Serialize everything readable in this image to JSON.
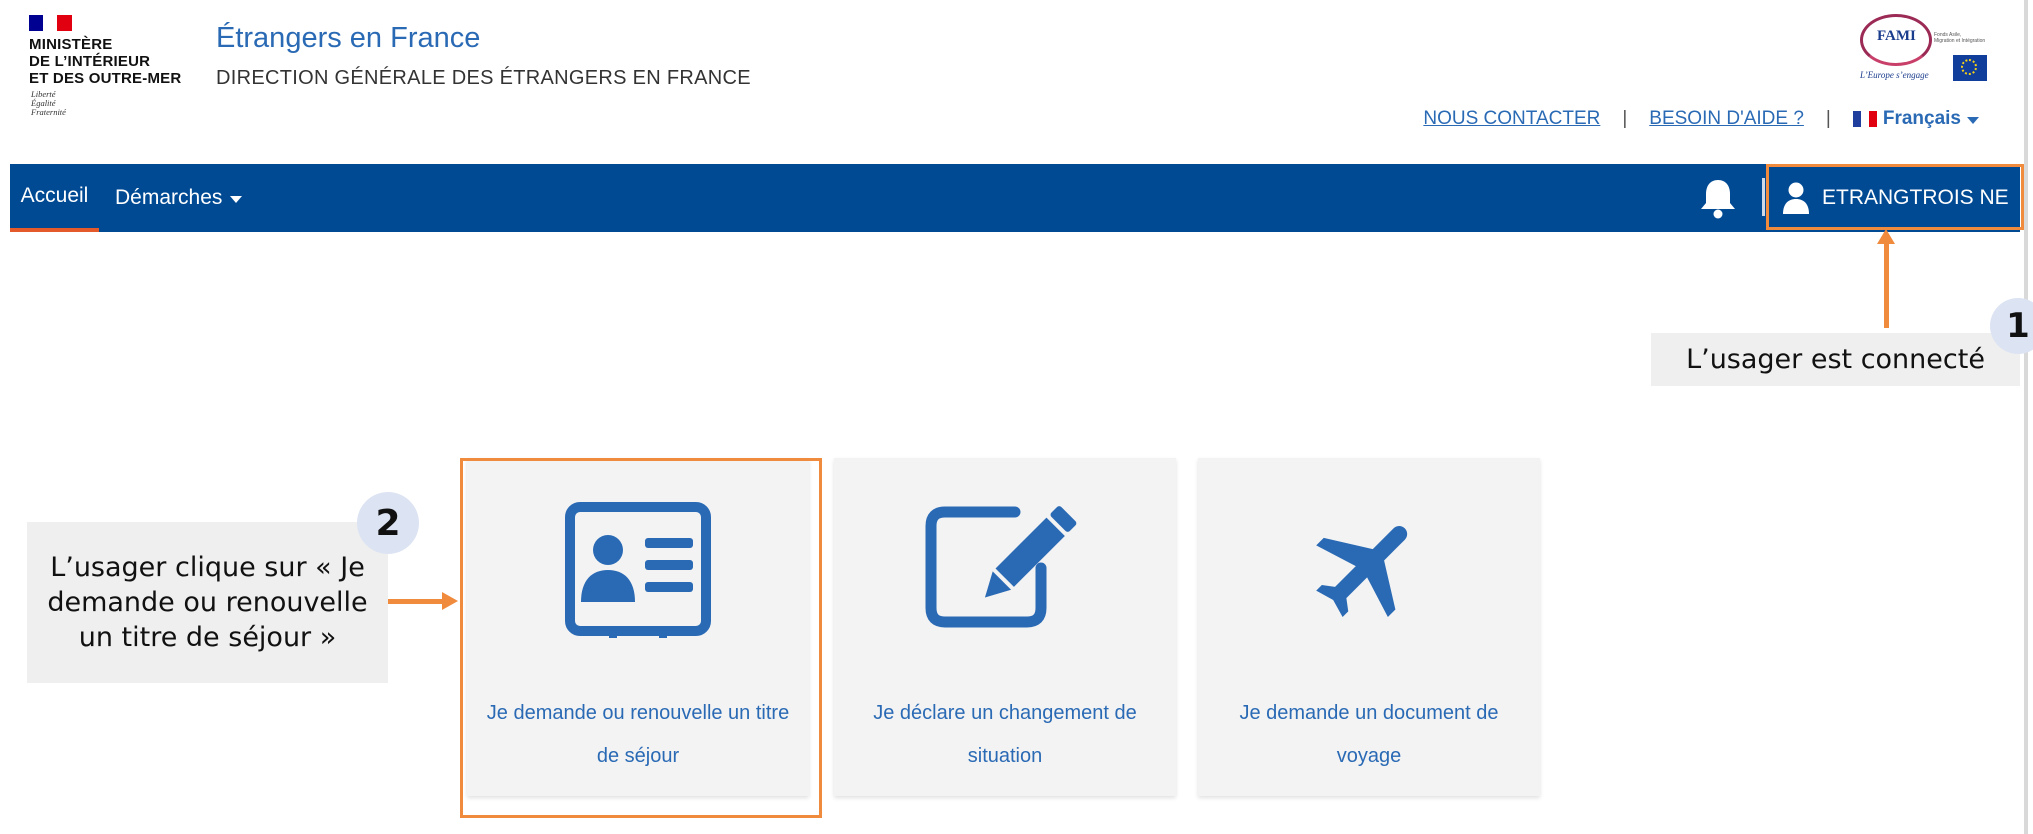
{
  "header": {
    "ministry_lines": [
      "MINISTÈRE",
      "DE L’INTÉRIEUR",
      "ET DES OUTRE-MER"
    ],
    "devise_lines": [
      "Liberté",
      "Égalité",
      "Fraternité"
    ],
    "site_title": "Étrangers en France",
    "site_subtitle": "DIRECTION GÉNÉRALE DES ÉTRANGERS EN FRANCE",
    "fami": {
      "word": "FAMI",
      "side_lines": [
        "Fonds Asile,",
        "Migration et Intégration"
      ],
      "motto": "L’Europe s’engage",
      "union_line": "Union européenne"
    },
    "links": {
      "contact": "NOUS CONTACTER",
      "help": "BESOIN D'AIDE ?",
      "separator": "|",
      "language": "Français"
    }
  },
  "navbar": {
    "home": "Accueil",
    "demarches": "Démarches",
    "user": "ETRANGTROIS NE"
  },
  "tiles": [
    {
      "label": "Je demande ou renouvelle un titre de séjour",
      "icon": "id-card-icon"
    },
    {
      "label": "Je déclare un changement de situation",
      "icon": "edit-icon"
    },
    {
      "label": "Je demande un document de voyage",
      "icon": "plane-icon"
    }
  ],
  "annotations": {
    "step1": {
      "number": "1",
      "text": "L’usager est connecté"
    },
    "step2": {
      "number": "2",
      "text": "L’usager clique sur « Je demande ou renouvelle un titre de séjour »"
    }
  },
  "colors": {
    "brand_blue": "#004a94",
    "link_blue": "#2a6ab5",
    "accent_orange": "#f08a3c",
    "active_tab_underline": "#e55a2b",
    "callout_bg": "#efefef",
    "badge_bg": "#dce3f2"
  }
}
